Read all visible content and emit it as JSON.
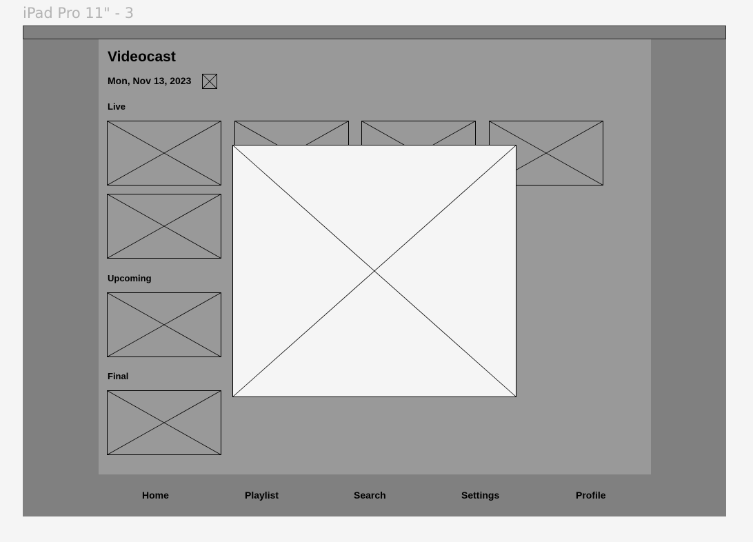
{
  "frame_label": "iPad Pro 11\" - 3",
  "app": {
    "title": "Videocast",
    "date": "Mon, Nov 13, 2023"
  },
  "sections": {
    "live": "Live",
    "upcoming": "Upcoming",
    "final": "Final"
  },
  "nav": {
    "items": [
      "Home",
      "Playlist",
      "Search",
      "Settings",
      "Profile"
    ]
  },
  "placeholder_icon": "image-placeholder-icon",
  "colors": {
    "canvas": "#f5f5f5",
    "device": "#808080",
    "content": "#999999",
    "modal": "#f5f5f5"
  }
}
